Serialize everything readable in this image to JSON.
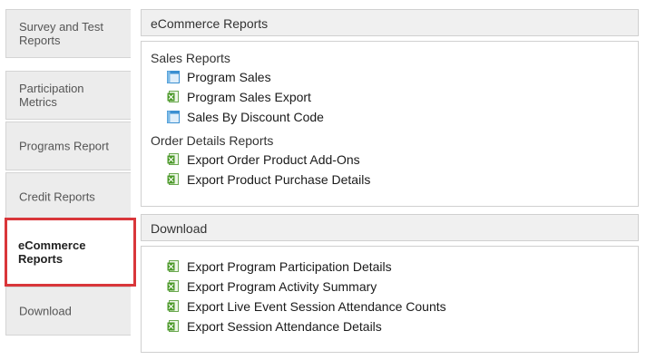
{
  "sidebar": {
    "tabs": [
      {
        "label": "Survey and Test Reports"
      },
      {
        "label": "Participation Metrics"
      },
      {
        "label": "Programs Report"
      },
      {
        "label": "Credit Reports"
      },
      {
        "label": "eCommerce Reports"
      },
      {
        "label": "Download"
      }
    ],
    "active_index": 4,
    "highlight_color": "#d9363a"
  },
  "ecommerce": {
    "header": "eCommerce Reports",
    "groups": [
      {
        "title": "Sales Reports",
        "items": [
          {
            "label": "Program Sales",
            "icon": "report-grid-icon"
          },
          {
            "label": "Program Sales Export",
            "icon": "spreadsheet-export-icon"
          },
          {
            "label": "Sales By Discount Code",
            "icon": "report-grid-icon"
          }
        ]
      },
      {
        "title": "Order Details Reports",
        "items": [
          {
            "label": "Export Order Product Add-Ons",
            "icon": "spreadsheet-export-icon"
          },
          {
            "label": "Export Product Purchase Details",
            "icon": "spreadsheet-export-icon"
          }
        ]
      }
    ]
  },
  "download": {
    "header": "Download",
    "items": [
      {
        "label": "Export Program Participation Details",
        "icon": "spreadsheet-export-icon"
      },
      {
        "label": "Export Program Activity Summary",
        "icon": "spreadsheet-export-icon"
      },
      {
        "label": "Export Live Event Session Attendance Counts",
        "icon": "spreadsheet-export-icon"
      },
      {
        "label": "Export Session Attendance Details",
        "icon": "spreadsheet-export-icon"
      }
    ]
  }
}
